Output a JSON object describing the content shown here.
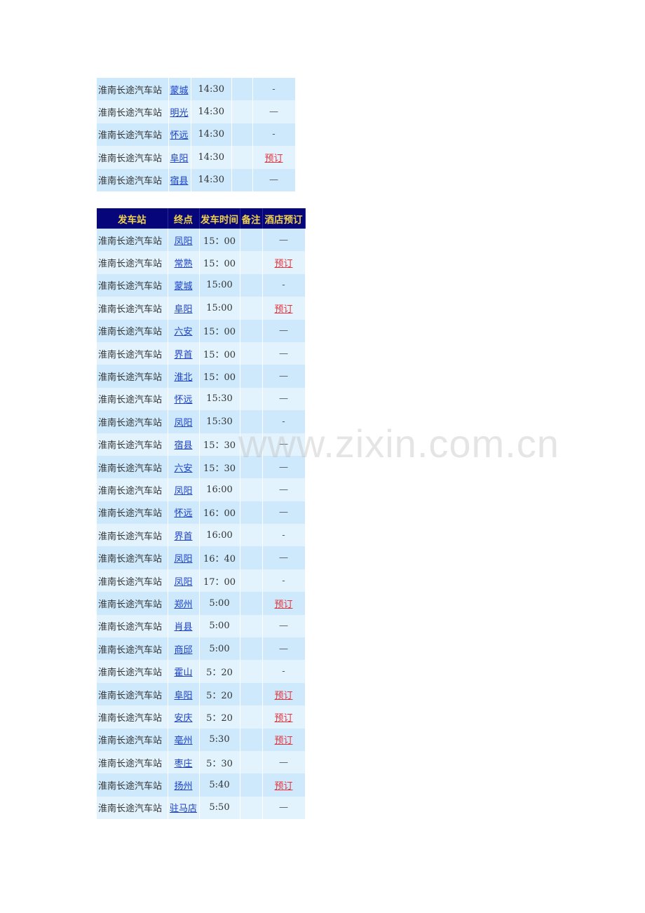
{
  "table1": {
    "rows": [
      {
        "station": "淮南长途汽车站",
        "destination": "蒙城",
        "time": "14:30",
        "remark": "",
        "hotel": "-",
        "hotel_type": "dash"
      },
      {
        "station": "淮南长途汽车站",
        "destination": "明光",
        "time": "14:30",
        "remark": "",
        "hotel": "—",
        "hotel_type": "dash"
      },
      {
        "station": "淮南长途汽车站",
        "destination": "怀远",
        "time": "14:30",
        "remark": "",
        "hotel": "-",
        "hotel_type": "dash"
      },
      {
        "station": "淮南长途汽车站",
        "destination": "阜阳",
        "time": "14:30",
        "remark": "",
        "hotel": "预订",
        "hotel_type": "link"
      },
      {
        "station": "淮南长途汽车站",
        "destination": "宿县",
        "time": "14:30",
        "remark": "",
        "hotel": "—",
        "hotel_type": "dash"
      }
    ]
  },
  "table2": {
    "headers": [
      "发车站",
      "终点",
      "发车时间",
      "备注",
      "酒店预订"
    ],
    "rows": [
      {
        "station": "淮南长途汽车站",
        "destination": "凤阳",
        "time": "15：00",
        "remark": "",
        "hotel": "—",
        "hotel_type": "dash"
      },
      {
        "station": "淮南长途汽车站",
        "destination": "常熟",
        "time": "15：00",
        "remark": "",
        "hotel": "预订",
        "hotel_type": "link"
      },
      {
        "station": "淮南长途汽车站",
        "destination": "蒙城",
        "time": "15:00",
        "remark": "",
        "hotel": "-",
        "hotel_type": "dash"
      },
      {
        "station": "淮南长途汽车站",
        "destination": "阜阳",
        "time": "15:00",
        "remark": "",
        "hotel": "预订",
        "hotel_type": "link"
      },
      {
        "station": "淮南长途汽车站",
        "destination": "六安",
        "time": "15：00",
        "remark": "",
        "hotel": "—",
        "hotel_type": "dash"
      },
      {
        "station": "淮南长途汽车站",
        "destination": "界首",
        "time": "15：00",
        "remark": "",
        "hotel": "—",
        "hotel_type": "dash"
      },
      {
        "station": "淮南长途汽车站",
        "destination": "淮北",
        "time": "15：00",
        "remark": "",
        "hotel": "—",
        "hotel_type": "dash"
      },
      {
        "station": "淮南长途汽车站",
        "destination": "怀远",
        "time": "15:30",
        "remark": "",
        "hotel": "—",
        "hotel_type": "dash"
      },
      {
        "station": "淮南长途汽车站",
        "destination": "凤阳",
        "time": "15:30",
        "remark": "",
        "hotel": "-",
        "hotel_type": "dash"
      },
      {
        "station": "淮南长途汽车站",
        "destination": "宿县",
        "time": "15：30",
        "remark": "",
        "hotel": "—",
        "hotel_type": "dash"
      },
      {
        "station": "淮南长途汽车站",
        "destination": "六安",
        "time": "15：30",
        "remark": "",
        "hotel": "—",
        "hotel_type": "dash"
      },
      {
        "station": "淮南长途汽车站",
        "destination": "凤阳",
        "time": "16:00",
        "remark": "",
        "hotel": "—",
        "hotel_type": "dash"
      },
      {
        "station": "淮南长途汽车站",
        "destination": "怀远",
        "time": "16：00",
        "remark": "",
        "hotel": "—",
        "hotel_type": "dash"
      },
      {
        "station": "淮南长途汽车站",
        "destination": "界首",
        "time": "16:00",
        "remark": "",
        "hotel": "-",
        "hotel_type": "dash"
      },
      {
        "station": "淮南长途汽车站",
        "destination": "凤阳",
        "time": "16：40",
        "remark": "",
        "hotel": "—",
        "hotel_type": "dash"
      },
      {
        "station": "淮南长途汽车站",
        "destination": "凤阳",
        "time": "17：00",
        "remark": "",
        "hotel": "-",
        "hotel_type": "dash"
      },
      {
        "station": "淮南长途汽车站",
        "destination": "郑州",
        "time": "5:00",
        "remark": "",
        "hotel": "预订",
        "hotel_type": "link"
      },
      {
        "station": "淮南长途汽车站",
        "destination": "肖县",
        "time": "5:00",
        "remark": "",
        "hotel": "—",
        "hotel_type": "dash"
      },
      {
        "station": "淮南长途汽车站",
        "destination": "商邱",
        "time": "5:00",
        "remark": "",
        "hotel": "—",
        "hotel_type": "dash"
      },
      {
        "station": "淮南长途汽车站",
        "destination": "霍山",
        "time": "5：20",
        "remark": "",
        "hotel": "-",
        "hotel_type": "dash"
      },
      {
        "station": "淮南长途汽车站",
        "destination": "阜阳",
        "time": "5：20",
        "remark": "",
        "hotel": "预订",
        "hotel_type": "link"
      },
      {
        "station": "淮南长途汽车站",
        "destination": "安庆",
        "time": "5：20",
        "remark": "",
        "hotel": "预订",
        "hotel_type": "link"
      },
      {
        "station": "淮南长途汽车站",
        "destination": "亳州",
        "time": "5:30",
        "remark": "",
        "hotel": "预订",
        "hotel_type": "link"
      },
      {
        "station": "淮南长途汽车站",
        "destination": "枣庄",
        "time": "5：30",
        "remark": "",
        "hotel": "—",
        "hotel_type": "dash"
      },
      {
        "station": "淮南长途汽车站",
        "destination": "扬州",
        "time": "5:40",
        "remark": "",
        "hotel": "预订",
        "hotel_type": "link"
      },
      {
        "station": "淮南长途汽车站",
        "destination": "驻马店",
        "time": "5:50",
        "remark": "",
        "hotel": "—",
        "hotel_type": "dash"
      }
    ]
  },
  "watermark": "www.zixin.com.cn",
  "colors": {
    "header_bg": "#06067a",
    "header_text": "#f0d34a",
    "row_odd": "#cde9fb",
    "row_even": "#e2f3fd",
    "link_blue": "#1a3fc8",
    "link_red": "#e8323a"
  }
}
